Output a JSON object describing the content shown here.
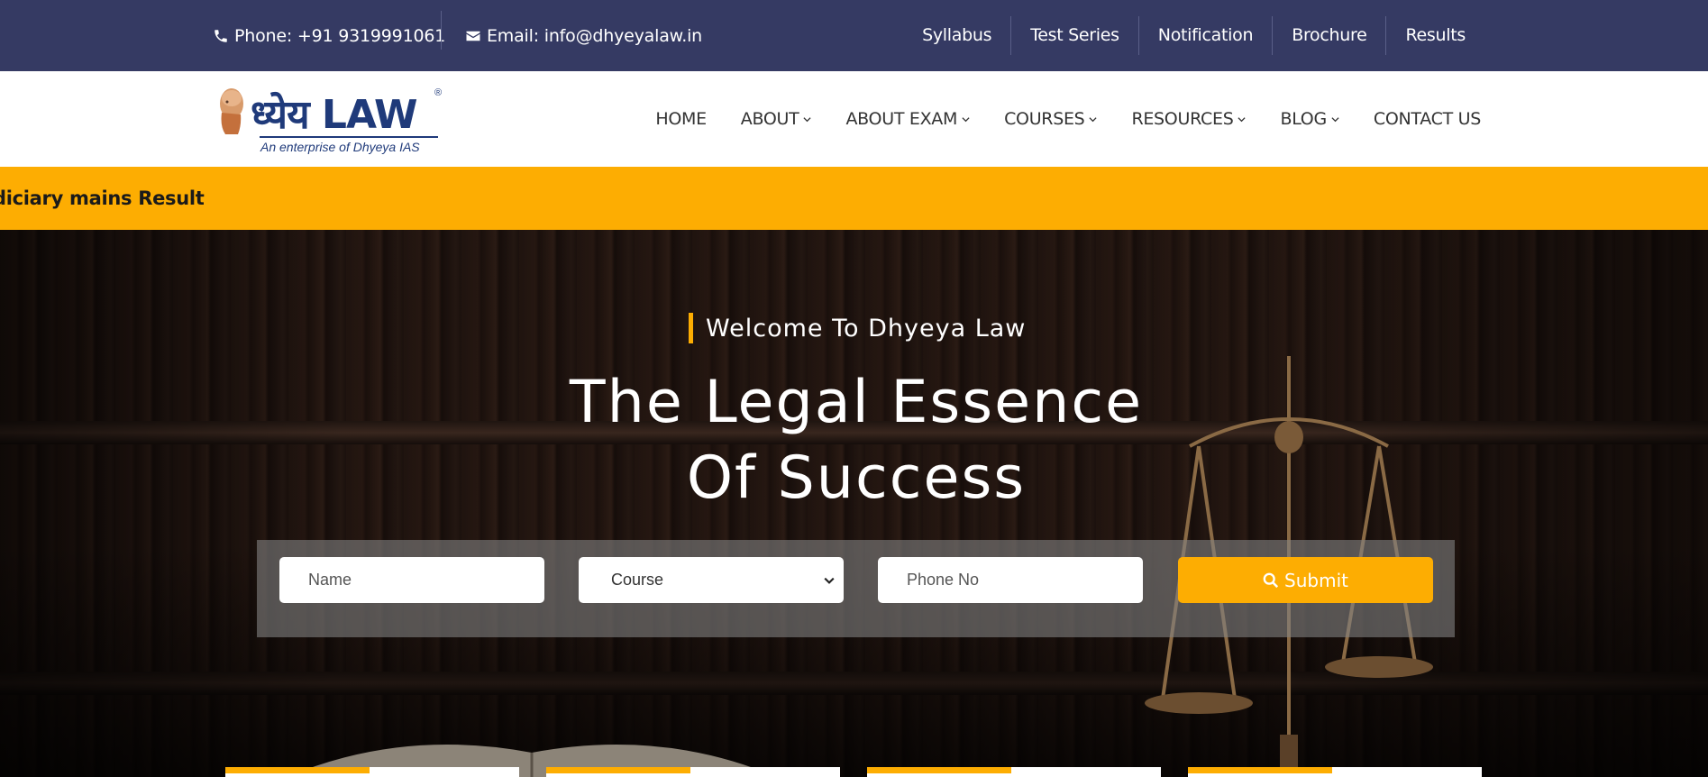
{
  "topbar": {
    "phone": "Phone: +91 9319991061",
    "email": "Email: info@dhyeyalaw.in",
    "links": [
      "Syllabus",
      "Test Series",
      "Notification",
      "Brochure",
      "Results"
    ]
  },
  "logo": {
    "brand_hindi": "ध्येय",
    "brand_law": "LAW",
    "registered": "®",
    "tagline": "An enterprise of Dhyeya IAS"
  },
  "nav": {
    "items": [
      {
        "label": "HOME",
        "dropdown": false
      },
      {
        "label": "ABOUT",
        "dropdown": true
      },
      {
        "label": "ABOUT EXAM",
        "dropdown": true
      },
      {
        "label": "COURSES",
        "dropdown": true
      },
      {
        "label": "RESOURCES",
        "dropdown": true
      },
      {
        "label": "BLOG",
        "dropdown": true
      },
      {
        "label": "CONTACT US",
        "dropdown": false
      }
    ]
  },
  "ticker": {
    "text": "diciary mains Result"
  },
  "hero": {
    "welcome": "Welcome To Dhyeya Law",
    "headline_line1": "The Legal Essence",
    "headline_line2": "Of Success"
  },
  "form": {
    "name_placeholder": "Name",
    "course_selected": "Course",
    "phone_placeholder": "Phone No",
    "submit_label": "Submit"
  },
  "colors": {
    "topbar_bg": "#353a63",
    "accent": "#fdad02",
    "brand": "#1f3a7a"
  }
}
